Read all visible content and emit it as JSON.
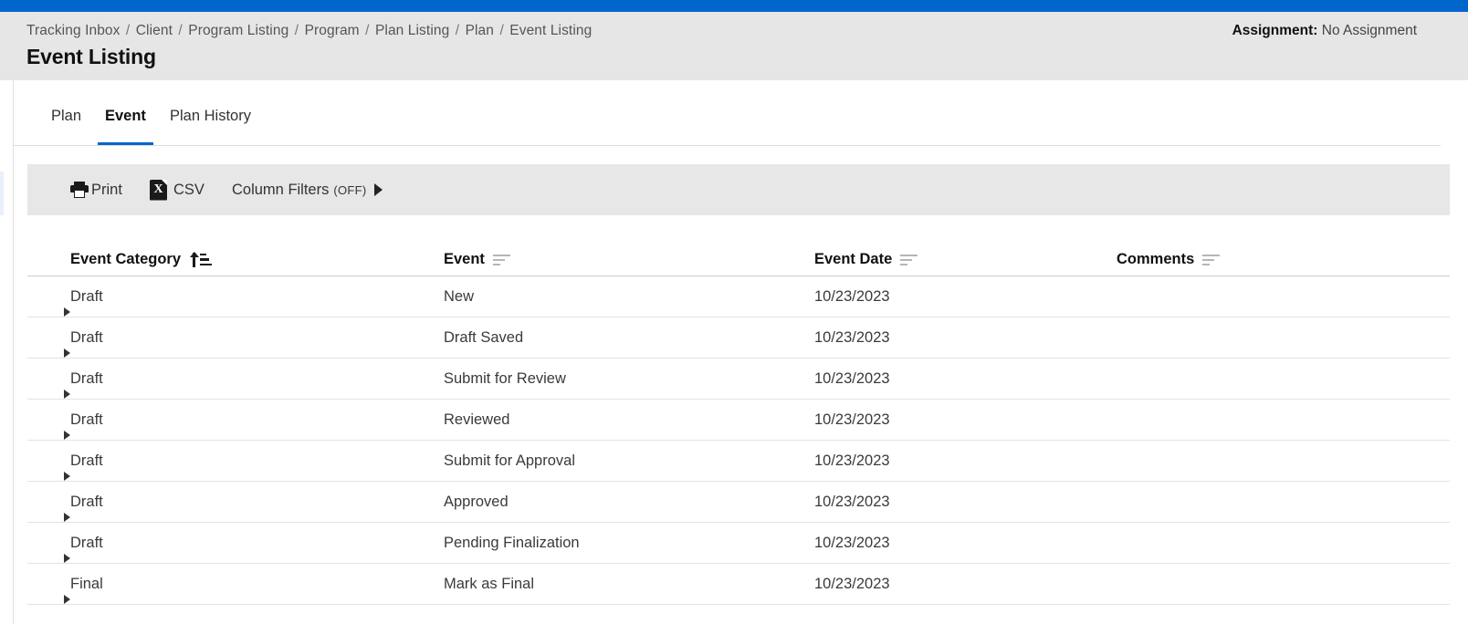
{
  "topbar": {
    "color": "#0066cc"
  },
  "header": {
    "breadcrumb": [
      "Tracking Inbox",
      "Client",
      "Program Listing",
      "Program",
      "Plan Listing",
      "Plan",
      "Event Listing"
    ],
    "separator": "/",
    "title": "Event Listing",
    "assignment_label": "Assignment:",
    "assignment_value": "No Assignment"
  },
  "tabs": [
    {
      "label": "Plan",
      "active": false
    },
    {
      "label": "Event",
      "active": true
    },
    {
      "label": "Plan History",
      "active": false
    }
  ],
  "toolbar": {
    "print_label": "Print",
    "print_icon": "printer-icon",
    "csv_label": "CSV",
    "csv_icon": "excel-file-icon",
    "csv_icon_glyph": "X",
    "filters_label": "Column Filters",
    "filters_state": "(OFF)",
    "filters_caret": "caret-right-icon"
  },
  "table": {
    "columns": [
      {
        "label": "Event Category",
        "sort": "ascending"
      },
      {
        "label": "Event",
        "sort": "none"
      },
      {
        "label": "Event Date",
        "sort": "none"
      },
      {
        "label": "Comments",
        "sort": "none"
      }
    ],
    "rows": [
      {
        "category": "Draft",
        "event": "New",
        "date": "10/23/2023",
        "comments": ""
      },
      {
        "category": "Draft",
        "event": "Draft Saved",
        "date": "10/23/2023",
        "comments": ""
      },
      {
        "category": "Draft",
        "event": "Submit for Review",
        "date": "10/23/2023",
        "comments": ""
      },
      {
        "category": "Draft",
        "event": "Reviewed",
        "date": "10/23/2023",
        "comments": ""
      },
      {
        "category": "Draft",
        "event": "Submit for Approval",
        "date": "10/23/2023",
        "comments": ""
      },
      {
        "category": "Draft",
        "event": "Approved",
        "date": "10/23/2023",
        "comments": ""
      },
      {
        "category": "Draft",
        "event": "Pending Finalization",
        "date": "10/23/2023",
        "comments": ""
      },
      {
        "category": "Final",
        "event": "Mark as Final",
        "date": "10/23/2023",
        "comments": ""
      }
    ]
  },
  "colors": {
    "accent": "#0066cc",
    "header_bg": "#e6e6e6",
    "toolbar_bg": "#e7e7e7",
    "text": "#333333"
  }
}
